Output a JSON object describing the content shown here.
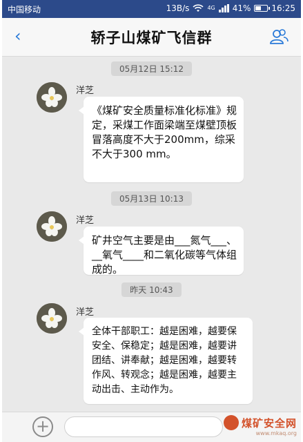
{
  "status_bar": {
    "carrier": "中国移动",
    "speed": "13B/s",
    "network": "4G",
    "battery": "41%",
    "time": "16:25"
  },
  "header": {
    "back_icon": "chevron-left-icon",
    "title": "轿子山煤矿飞信群",
    "group_icon": "group-members-icon"
  },
  "messages": [
    {
      "timestamp": "05月12日  15:12",
      "sender": "洋芝",
      "text": "《煤矿安全质量标准化标准》规定，采煤工作面梁端至煤壁顶板冒落高度不大于200mm，综采不大于300 mm。"
    },
    {
      "timestamp": "05月13日  10:13",
      "sender": "洋芝",
      "text": "矿井空气主要是由___氮气___、__氧气____和二氧化碳等气体组成的。"
    },
    {
      "timestamp": "昨天 10:43",
      "sender": "洋芝",
      "text": "全体干部职工：越是困难，越要保安全、保稳定；越是困难，越要讲团结、讲奉献；越是困难，越要转作风、转观念；越是困难，越要主动出击、主动作为。"
    }
  ],
  "input_bar": {
    "add_icon": "plus-icon",
    "placeholder": ""
  },
  "watermark": {
    "text": "煤矿安全网",
    "url": "www.mkaq.org"
  },
  "colors": {
    "status_bar": "#2c4a8a",
    "accent": "#2a7ad8",
    "watermark": "#d3522b"
  }
}
